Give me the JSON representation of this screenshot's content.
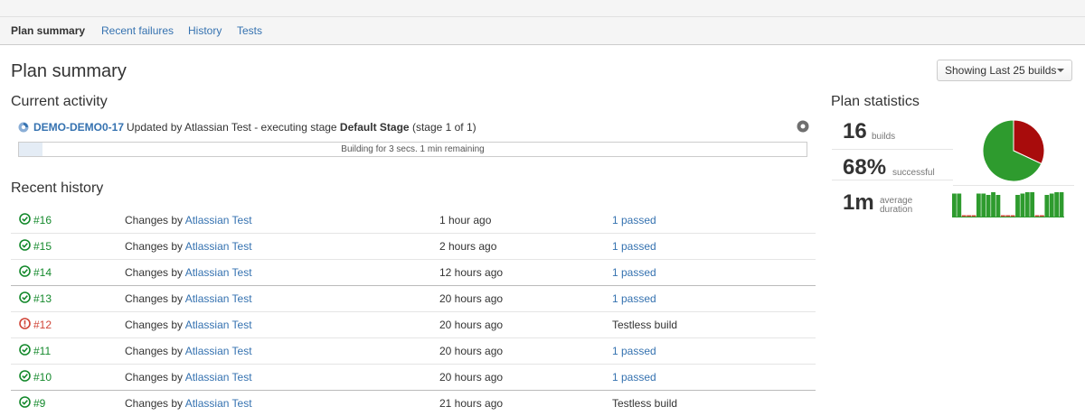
{
  "tabs": [
    {
      "label": "Plan summary",
      "active": true
    },
    {
      "label": "Recent failures",
      "active": false
    },
    {
      "label": "History",
      "active": false
    },
    {
      "label": "Tests",
      "active": false
    }
  ],
  "page_title": "Plan summary",
  "builds_dropdown": {
    "label": "Showing Last 25 builds"
  },
  "current_activity": {
    "title": "Current activity",
    "build": "DEMO-DEMO0-17",
    "text_prefix": "Updated by Atlassian Test - executing stage ",
    "stage": "Default Stage",
    "text_suffix": " (stage 1 of 1)",
    "progress_text": "Building for 3 secs. 1 min remaining",
    "progress_fraction": 0.03
  },
  "recent_history": {
    "title": "Recent history",
    "changes_label": "Changes by",
    "rows": [
      {
        "build": "#16",
        "status": "success",
        "author": "Atlassian Test",
        "when": "1 hour ago",
        "result": "1 passed",
        "result_is_link": true
      },
      {
        "build": "#15",
        "status": "success",
        "author": "Atlassian Test",
        "when": "2 hours ago",
        "result": "1 passed",
        "result_is_link": true
      },
      {
        "build": "#14",
        "status": "success",
        "author": "Atlassian Test",
        "when": "12 hours ago",
        "result": "1 passed",
        "result_is_link": true
      },
      {
        "build": "#13",
        "status": "success",
        "author": "Atlassian Test",
        "when": "20 hours ago",
        "result": "1 passed",
        "result_is_link": true
      },
      {
        "build": "#12",
        "status": "failed",
        "author": "Atlassian Test",
        "when": "20 hours ago",
        "result": "Testless build",
        "result_is_link": false
      },
      {
        "build": "#11",
        "status": "success",
        "author": "Atlassian Test",
        "when": "20 hours ago",
        "result": "1 passed",
        "result_is_link": true
      },
      {
        "build": "#10",
        "status": "success",
        "author": "Atlassian Test",
        "when": "20 hours ago",
        "result": "1 passed",
        "result_is_link": true
      },
      {
        "build": "#9",
        "status": "success",
        "author": "Atlassian Test",
        "when": "21 hours ago",
        "result": "Testless build",
        "result_is_link": false
      }
    ]
  },
  "plan_statistics": {
    "title": "Plan statistics",
    "builds_value": "16",
    "builds_label": "builds",
    "success_value": "68%",
    "success_label": "successful",
    "success_fraction": 0.68,
    "duration_value": "1m",
    "duration_label_1": "average",
    "duration_label_2": "duration",
    "duration_bars": [
      0.85,
      0.85,
      0.05,
      0.05,
      0.05,
      0.85,
      0.85,
      0.8,
      0.9,
      0.8,
      0.05,
      0.05,
      0.05,
      0.8,
      0.85,
      0.9,
      0.9,
      0.05,
      0.05,
      0.8,
      0.85,
      0.9,
      0.9
    ]
  },
  "colors": {
    "success": "#14892c",
    "failed": "#d04437",
    "link": "#3572b0",
    "pie_success": "#2e9b2e",
    "pie_failed": "#a80c0c"
  },
  "icons": {
    "building": "spinner-icon",
    "stop": "stop-icon",
    "success": "check-circle-icon",
    "failed": "exclamation-circle-icon"
  }
}
